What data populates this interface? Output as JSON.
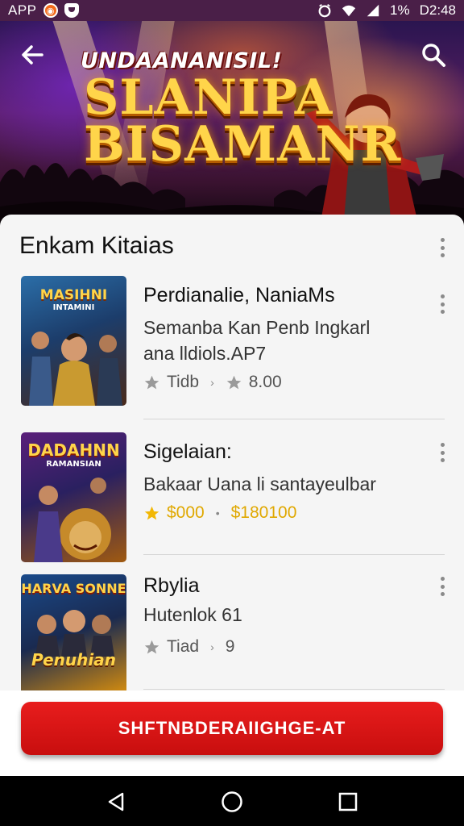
{
  "status_bar": {
    "app_label": "APP",
    "battery": "1%",
    "time": "D2:48"
  },
  "banner": {
    "top_text": "UNDAANANISIL!",
    "title_line1": "SLANIPA",
    "title_line2": "BISAMANR"
  },
  "section": {
    "title": "Enkam Kitaias"
  },
  "items": [
    {
      "thumb_title": "MASIHNI",
      "thumb_sub": "INTAMINI",
      "title": "Perdianalie, NaniaMs",
      "desc_line1": "Semanba Kan Penb Ingkarl",
      "desc_line2": "ana lldiols.AP7",
      "meta_left": "Tidb",
      "meta_right": "8.00"
    },
    {
      "thumb_title": "DADAHNN",
      "thumb_sub": "RAMANSIAN",
      "title": "Sigelaian:",
      "desc_line1": "Bakaar Uana li santayeulbar",
      "meta_left": "$000",
      "meta_right": "$180100"
    },
    {
      "thumb_title": "HARVA SONNE",
      "thumb_sub": "Penuhian",
      "title": "Rbylia",
      "desc_line1": "Hutenlok 61",
      "meta_left": "Tiad",
      "meta_right": "9"
    }
  ],
  "cta": {
    "label": "SHFTNBDERAIIGHGE-AT"
  },
  "colors": {
    "accent": "#d41414",
    "status_bar": "#4a1f48",
    "star_gray": "#9a9a9a",
    "star_gold": "#f2b705"
  },
  "icons": [
    "back-arrow-icon",
    "search-icon",
    "kebab-menu-icon",
    "star-icon",
    "nav-back-icon",
    "nav-home-icon",
    "nav-recents-icon",
    "wifi-icon",
    "signal-icon",
    "alarm-icon"
  ]
}
